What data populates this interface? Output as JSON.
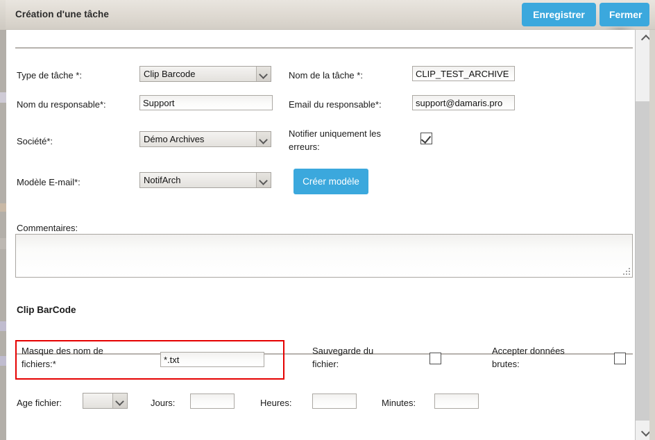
{
  "window": {
    "title": "Création d'une tâche",
    "save_label": "Enregistrer",
    "close_label": "Fermer",
    "accent_color": "#3ba8dd"
  },
  "form": {
    "fields": {
      "task_type": {
        "label": "Type de tâche *:",
        "value": "Clip Barcode",
        "control": "select"
      },
      "task_name": {
        "label": "Nom de la tâche *:",
        "value": "CLIP_TEST_ARCHIVE",
        "control": "text"
      },
      "manager_name": {
        "label": "Nom du responsable*:",
        "value": "Support",
        "control": "text"
      },
      "manager_email": {
        "label": "Email du responsable*:",
        "value": "support@damaris.pro",
        "control": "text"
      },
      "company": {
        "label": "Société*:",
        "value": "Démo Archives",
        "control": "select"
      },
      "notify_errors_only": {
        "label": "Notifier uniquement les erreurs:",
        "checked": true,
        "control": "checkbox"
      },
      "email_template": {
        "label": "Modèle E-mail*:",
        "value": "NotifArch",
        "control": "select"
      },
      "create_template": {
        "label": "Créer modèle",
        "control": "button"
      },
      "comments": {
        "label": "Commentaires:",
        "value": "",
        "control": "textarea"
      }
    }
  },
  "clip_barcode": {
    "section_title": "Clip BarCode",
    "highlight_color": "#e50000",
    "fields": {
      "file_name_mask": {
        "label": "Masque des nom de fichiers:*",
        "value": "*.txt",
        "control": "text",
        "highlighted": true
      },
      "file_backup": {
        "label": "Sauvegarde du fichier:",
        "checked": false,
        "control": "checkbox"
      },
      "accept_raw_data": {
        "label": "Accepter données brutes:",
        "checked": false,
        "control": "checkbox"
      },
      "file_age": {
        "label": "Age fichier:",
        "value": "",
        "control": "select"
      },
      "days": {
        "label": "Jours:",
        "value": "",
        "control": "text"
      },
      "hours": {
        "label": "Heures:",
        "value": "",
        "control": "text"
      },
      "minutes": {
        "label": "Minutes:",
        "value": "",
        "control": "text"
      }
    }
  },
  "scrollbar": {
    "up_icon": "chevron-up-icon",
    "down_icon": "chevron-down-icon"
  }
}
